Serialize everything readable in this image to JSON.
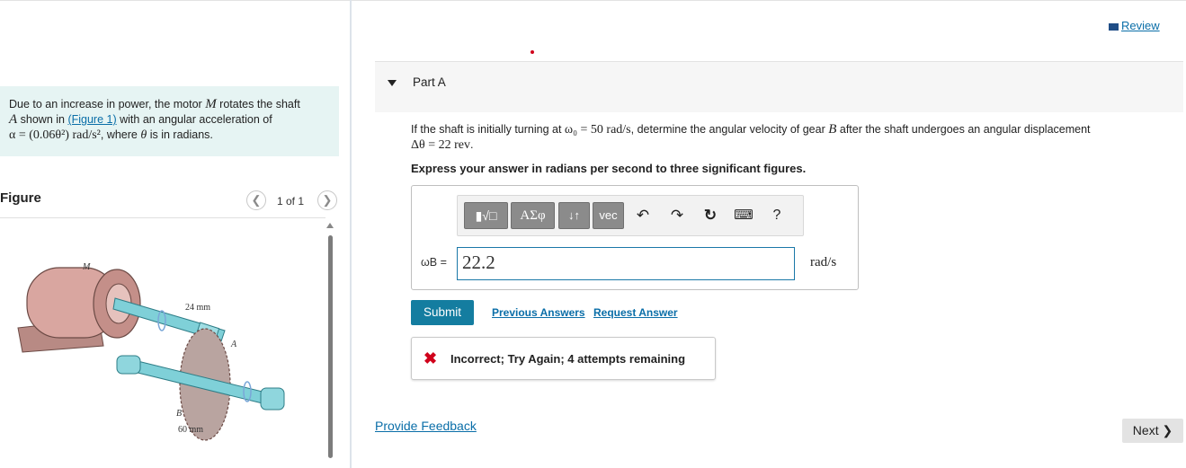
{
  "review_label": "Review",
  "problem": {
    "text_1": "Due to an increase in power, the motor ",
    "motor_var": "M",
    "text_2": " rotates the shaft",
    "shaft_var": "A",
    "text_3": " shown in ",
    "figure_link": "(Figure 1)",
    "text_4": " with an angular acceleration of",
    "formula": "α = (0.06θ²) rad/s²",
    "text_5": ", where ",
    "theta": "θ",
    "text_6": " is in radians."
  },
  "figure": {
    "title": "Figure",
    "pager": "1 of 1",
    "labels": {
      "motor": "M",
      "dim_a": "24 mm",
      "shaft": "A",
      "gear": "B",
      "dim_b": "60 mm"
    }
  },
  "part": {
    "label": "Part A",
    "question_1": "If the shaft is initially turning at ",
    "omega0": "ω₀ = 50 rad/s",
    "question_2": ", determine the angular velocity of gear ",
    "gear_var": "B",
    "question_3": " after the shaft undergoes an angular displacement",
    "displacement": "Δθ = 22 rev",
    "question_4": ".",
    "instruction": "Express your answer in radians per second to three significant figures."
  },
  "toolbar": {
    "templates": "▮√□",
    "symbols": "ΑΣφ",
    "arrows": "↓↑",
    "vec": "vec",
    "undo": "↶",
    "redo": "↷",
    "reset": "↻",
    "keyboard": "⌨",
    "help": "?"
  },
  "answer": {
    "label": "ωB =",
    "value": "22.2",
    "unit": "rad/s"
  },
  "buttons": {
    "submit": "Submit",
    "previous_answers": "Previous Answers",
    "request_answer": "Request Answer",
    "next": "Next ❯",
    "provide_feedback": "Provide Feedback"
  },
  "feedback": {
    "icon": "✖",
    "text": "Incorrect; Try Again; 4 attempts remaining"
  },
  "colors": {
    "accent": "#147da0",
    "problem_bg": "#e6f4f3",
    "error": "#d0021b",
    "link": "#0a6ea8"
  }
}
